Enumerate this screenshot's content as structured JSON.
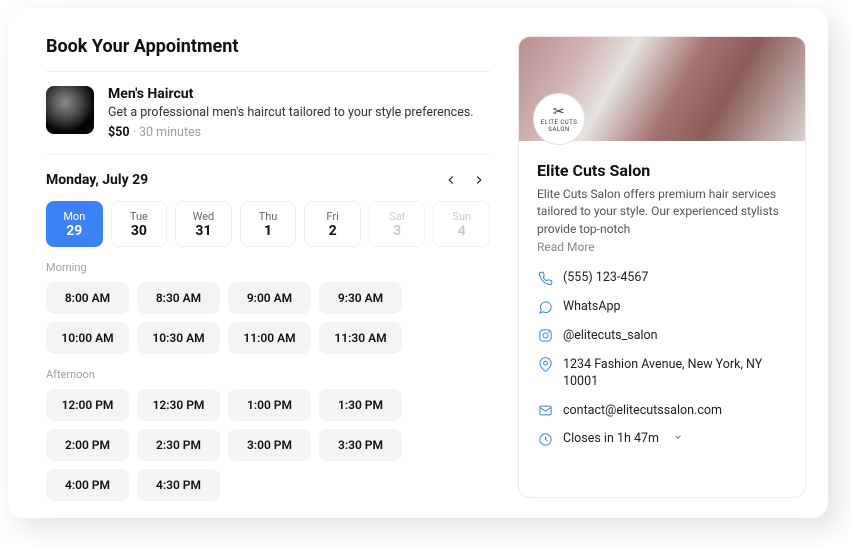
{
  "title": "Book Your Appointment",
  "service": {
    "name": "Men's Haircut",
    "desc": "Get a professional men's haircut tailored to your style preferences.",
    "price": "$50",
    "dot": "·",
    "duration": "30 minutes"
  },
  "calendar": {
    "selected_label": "Monday, July 29",
    "days": [
      {
        "dow": "Mon",
        "num": "29",
        "selected": true,
        "disabled": false
      },
      {
        "dow": "Tue",
        "num": "30",
        "selected": false,
        "disabled": false
      },
      {
        "dow": "Wed",
        "num": "31",
        "selected": false,
        "disabled": false
      },
      {
        "dow": "Thu",
        "num": "1",
        "selected": false,
        "disabled": false
      },
      {
        "dow": "Fri",
        "num": "2",
        "selected": false,
        "disabled": false
      },
      {
        "dow": "Sat",
        "num": "3",
        "selected": false,
        "disabled": true
      },
      {
        "dow": "Sun",
        "num": "4",
        "selected": false,
        "disabled": true
      }
    ]
  },
  "sections": {
    "morning_label": "Morning",
    "afternoon_label": "Afternoon"
  },
  "morning": [
    "8:00 AM",
    "8:30 AM",
    "9:00 AM",
    "9:30 AM",
    "10:00 AM",
    "10:30 AM",
    "11:00 AM",
    "11:30 AM"
  ],
  "afternoon": [
    "12:00 PM",
    "12:30 PM",
    "1:00 PM",
    "1:30 PM",
    "2:00 PM",
    "2:30 PM",
    "3:00 PM",
    "3:30 PM",
    "4:00 PM",
    "4:30 PM"
  ],
  "business": {
    "logo_top": "ELITE CUTS",
    "logo_sub": "SALON",
    "name": "Elite Cuts Salon",
    "desc": "Elite Cuts Salon offers premium hair services tailored to your style. Our experienced stylists provide top-notch",
    "read_more": "Read More",
    "phone": "(555) 123-4567",
    "whatsapp": "WhatsApp",
    "instagram": "@elitecuts_salon",
    "address": "1234 Fashion Avenue, New York, NY 10001",
    "email": "contact@elitecutssalon.com",
    "hours": "Closes in 1h 47m"
  }
}
